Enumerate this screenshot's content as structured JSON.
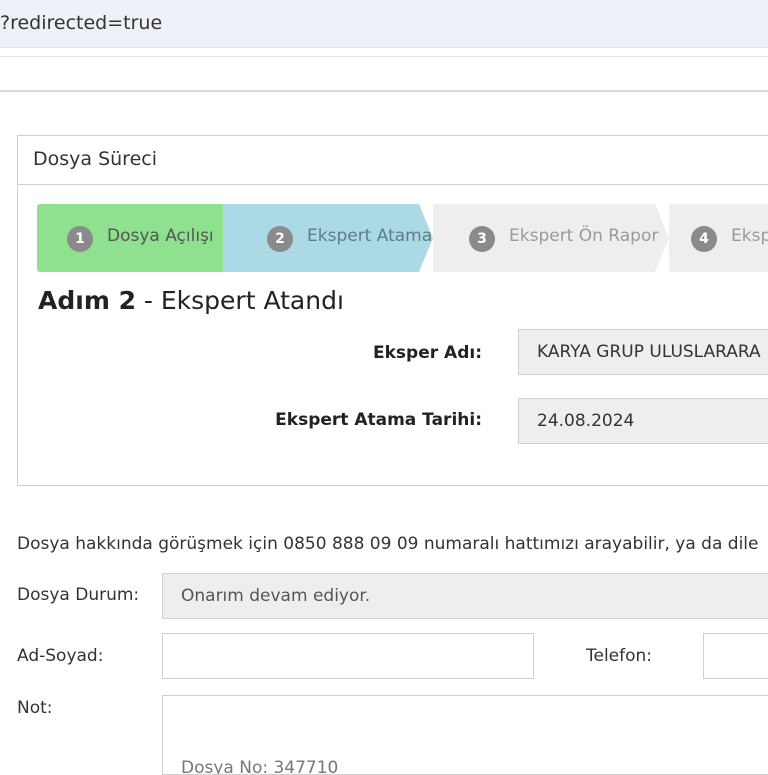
{
  "browser": {
    "url_fragment": "?redirected=true"
  },
  "panel": {
    "title": "Dosya Süreci",
    "steps": [
      {
        "number": "1",
        "label": "Dosya Açılışı",
        "state": "done",
        "color": "#8fe08f",
        "text_color": "#555555"
      },
      {
        "number": "2",
        "label": "Ekspert Atama",
        "state": "active",
        "color": "#acd9e6",
        "text_color": "#5a7f8c"
      },
      {
        "number": "3",
        "label": "Ekspert Ön Rapor",
        "state": "pending",
        "color": "#eeeeee",
        "text_color": "#9a9a9a"
      },
      {
        "number": "4",
        "label": "Eksper",
        "state": "pending",
        "color": "#eeeeee",
        "text_color": "#9a9a9a"
      }
    ],
    "heading_bold": "Adım 2",
    "heading_rest": " - Ekspert Atandı",
    "expert_name_label": "Eksper Adı:",
    "expert_name_value": "KARYA GRUP ULUSLARARA",
    "expert_date_label": "Ekspert Atama Tarihi:",
    "expert_date_value": "24.08.2024"
  },
  "form": {
    "info_text": "Dosya hakkında görüşmek için 0850 888 09 09 numaralı hattımızı arayabilir, ya da dile",
    "status_label": "Dosya Durum:",
    "status_value": "Onarım devam ediyor.",
    "name_label": "Ad-Soyad:",
    "name_value": "",
    "phone_label": "Telefon:",
    "phone_value": "",
    "note_label": "Not:",
    "note_peek": "Dosya No: 347710"
  }
}
